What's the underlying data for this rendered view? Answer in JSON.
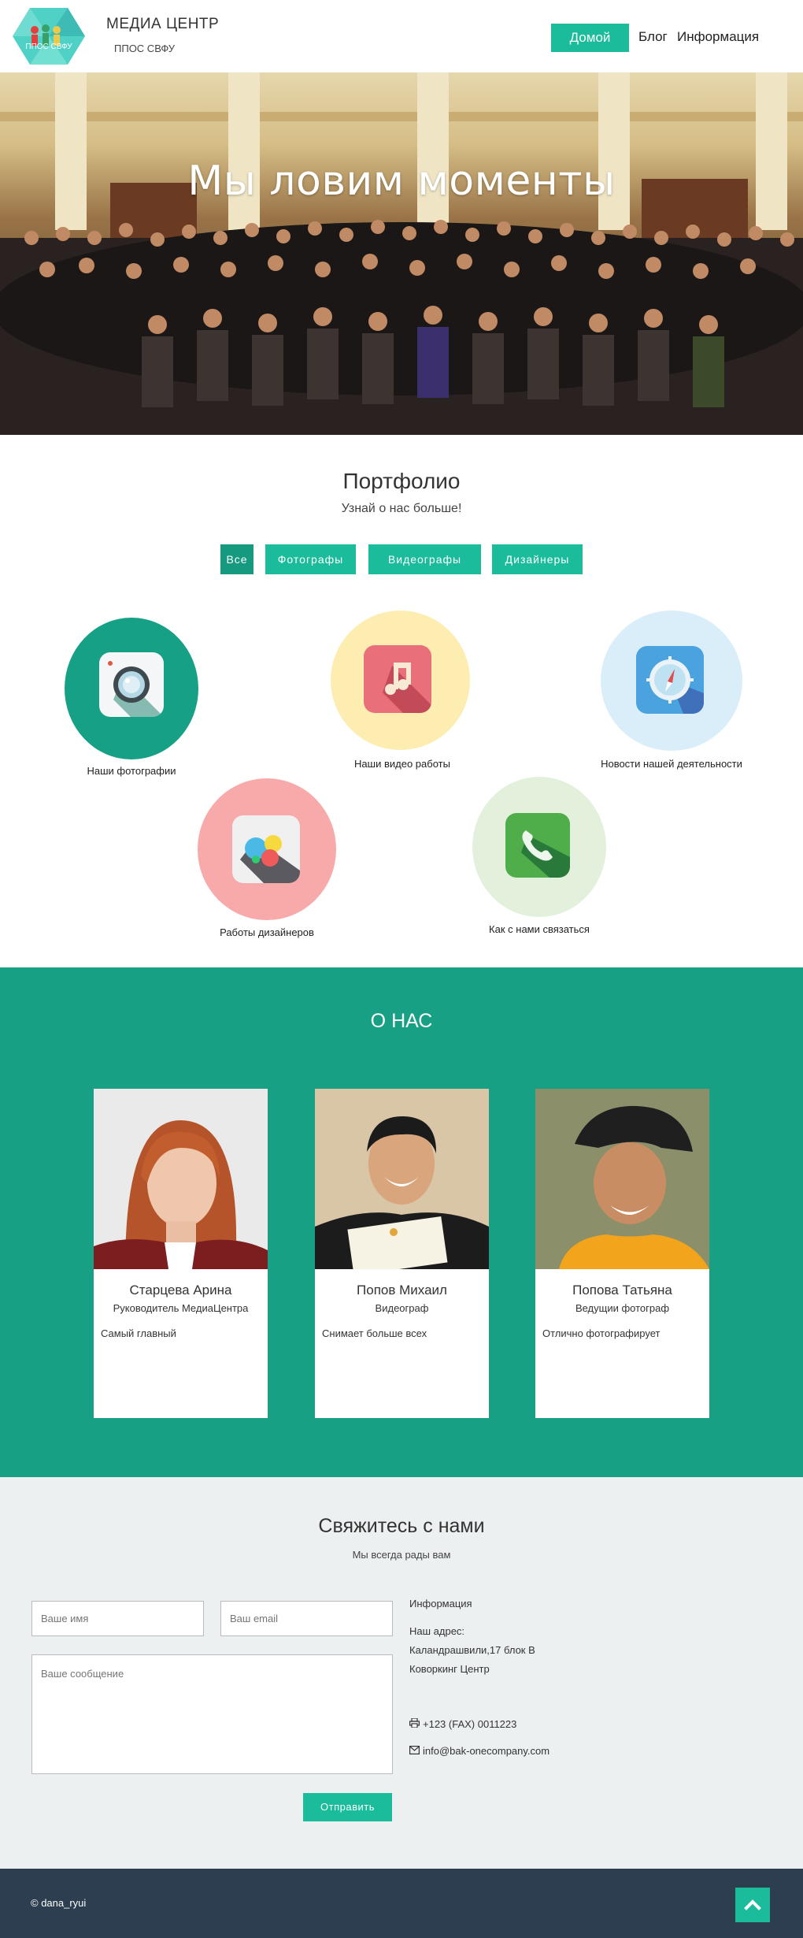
{
  "nav": {
    "logo_text": "ППОС СВФУ",
    "brand_title": "МЕДИА ЦЕНТР",
    "brand_subtitle": "ППОС СВФУ",
    "links": [
      "Домой",
      "Блог",
      "Информация"
    ]
  },
  "hero": {
    "title": "Мы ловим моменты"
  },
  "portfolio": {
    "title": "Портфолио",
    "subtitle": "Узнай о нас больше!",
    "filters": [
      "Все",
      "Фотографы",
      "Видеографы",
      "Дизайнеры"
    ],
    "items": [
      {
        "label": "Наши фотографии",
        "icon": "camera-icon"
      },
      {
        "label": "Наши видео работы",
        "icon": "music-note-icon"
      },
      {
        "label": "Новости нашей деятельности",
        "icon": "compass-icon"
      },
      {
        "label": "Работы дизайнеров",
        "icon": "palette-icon"
      },
      {
        "label": "Как с нами связаться",
        "icon": "phone-icon"
      }
    ]
  },
  "about": {
    "title": "О НАС",
    "members": [
      {
        "name": "Старцева Арина",
        "role": "Руководитель МедиаЦентра",
        "desc": "Самый главный"
      },
      {
        "name": "Попов Михаил",
        "role": "Видеограф",
        "desc": "Снимает больше всех"
      },
      {
        "name": "Попова Татьяна",
        "role": "Ведущии фотограф",
        "desc": "Отлично фотографирует"
      }
    ]
  },
  "contact": {
    "title": "Свяжитесь с нами",
    "subtitle": "Мы всегда рады вам",
    "name_placeholder": "Ваше имя",
    "email_placeholder": "Ваш email",
    "message_placeholder": "Ваше сообщение",
    "send_label": "Отправить",
    "info_heading": "Информация",
    "address_label": "Наш адрес:",
    "address_line1": "Каландрашвили,17 блок В",
    "address_line2": "Коворкинг Центр",
    "phone": "+123 (FAX) 0011223",
    "email": "info@bak-onecompany.com"
  },
  "footer": {
    "copyright": "© dana_ryui"
  },
  "colors": {
    "accent": "#1abc9c",
    "about_bg": "#18a085",
    "contact_bg": "#ecf0f1",
    "footer_bg": "#2c3e50"
  }
}
